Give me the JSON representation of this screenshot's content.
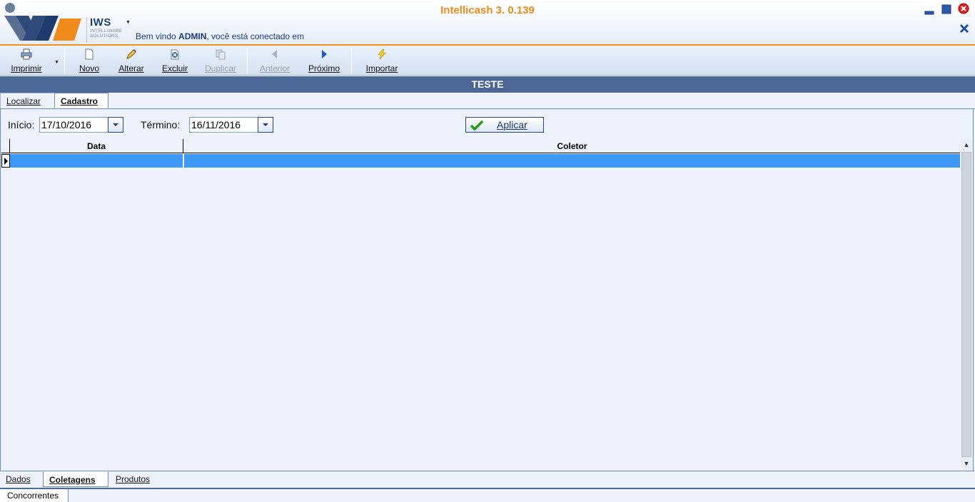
{
  "app": {
    "title": "Intellicash 3. 0.139",
    "brand_name": "IWS",
    "brand_sub1": "INTELLIWARE",
    "brand_sub2": "SOLUTIONS",
    "welcome_prefix": "Bem vindo ",
    "welcome_user": "ADMIN",
    "welcome_suffix": ", você está conectado em"
  },
  "toolbar": {
    "imprimir": "Imprimir",
    "novo": "Novo",
    "alterar": "Alterar",
    "excluir": "Excluir",
    "duplicar": "Duplicar",
    "anterior": "Anterior",
    "proximo": "Próximo",
    "importar": "Importar"
  },
  "section": {
    "title": "TESTE"
  },
  "tabs_top": [
    "Localizar",
    "Cadastro"
  ],
  "filters": {
    "inicio_label": "Início:",
    "inicio_value": "17/10/2016",
    "termino_label": "Término:",
    "termino_value": "16/11/2016",
    "apply_label": "Aplicar"
  },
  "grid": {
    "columns": [
      "Data",
      "Coletor"
    ],
    "rows": [
      [
        "",
        ""
      ]
    ]
  },
  "tabs_bottom": [
    "Dados",
    "Coletagens",
    "Produtos"
  ],
  "tabs_bottom2": [
    "Concorrentes"
  ],
  "colors": {
    "accent_orange": "#f08a1a",
    "header_blue": "#4c6897",
    "selection_blue": "#3d99f5"
  }
}
